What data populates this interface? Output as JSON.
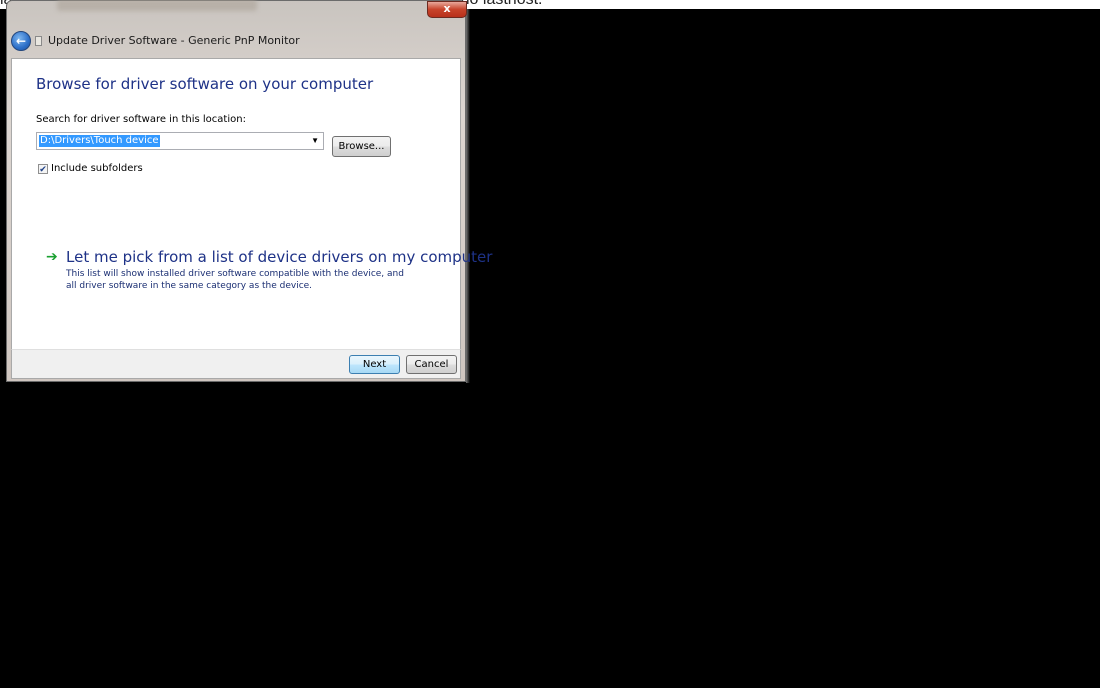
{
  "background_caption": "lastanite lastnost SLIDE BAR (DRSNIK) na optimalno predstavljeno lastnost.",
  "window": {
    "title": "Update Driver Software - Generic PnP Monitor",
    "close_glyph": "x",
    "back_glyph": "←"
  },
  "content": {
    "heading": "Browse for driver software on your computer",
    "search_label": "Search for driver software in this location:",
    "path_value": "D:\\Drivers\\Touch device",
    "combo_arrow": "▼",
    "browse_label": "Browse...",
    "include_subfolders": {
      "checked": true,
      "check_glyph": "✔",
      "label": "Include subfolders"
    },
    "pick": {
      "arrow_glyph": "➔",
      "title": "Let me pick from a list of device drivers on my computer",
      "description": "This list will show installed driver software compatible with the device, and all driver software in the same category as the device."
    }
  },
  "footer": {
    "next_label": "Next",
    "cancel_label": "Cancel"
  },
  "colors": {
    "heading": "#1e3287",
    "selection": "#3399ff",
    "arrow_green": "#1aa030",
    "close_red": "#c7432a"
  },
  "icons": {
    "back": "back-arrow-icon",
    "monitor": "monitor-icon",
    "close": "close-icon",
    "dropdown": "chevron-down-icon",
    "pick": "green-arrow-icon",
    "checkbox": "checkmark-icon"
  }
}
